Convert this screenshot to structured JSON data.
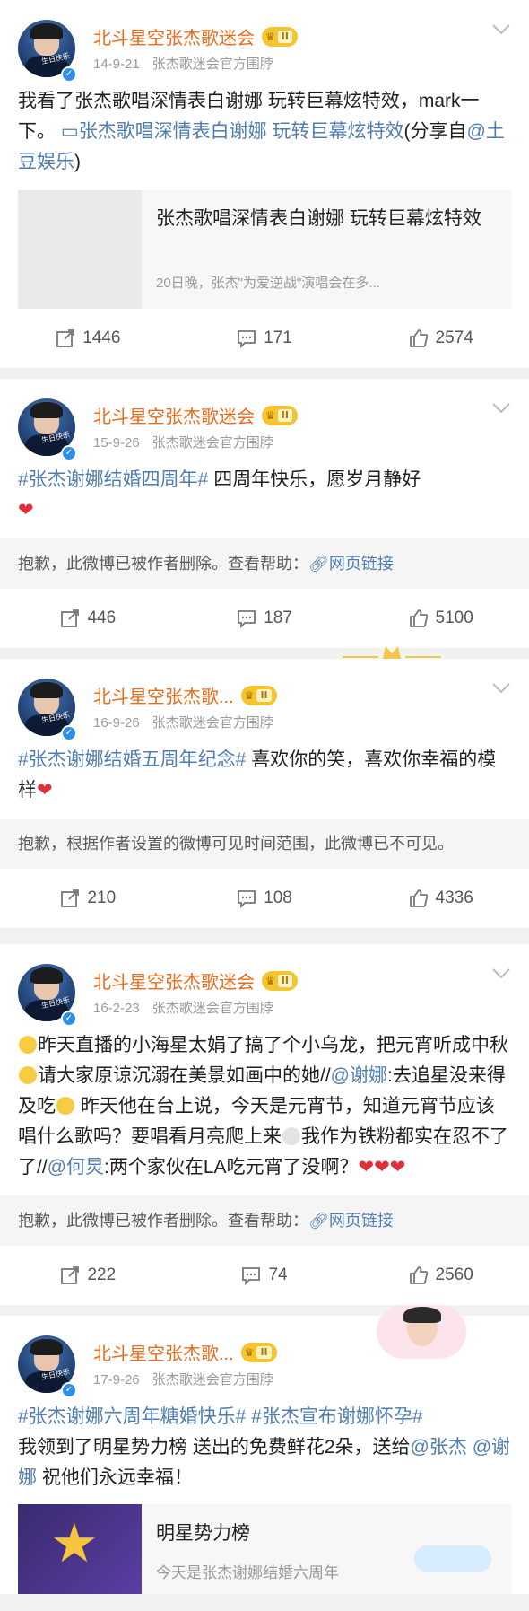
{
  "posts": [
    {
      "author": "北斗星空张杰歌迷会",
      "level": "II",
      "date": "14-9-21",
      "source": "张杰歌迷会官方围脖",
      "text_a": "我看了张杰歌唱深情表白谢娜 玩转巨幕炫特效，mark一下。",
      "text_link": "张杰歌唱深情表白谢娜 玩转巨幕炫特效",
      "text_b": "(分享自",
      "text_mention": "@土豆娱乐",
      "text_c": ")",
      "card_title": "张杰歌唱深情表白谢娜 玩转巨幕炫特效",
      "card_desc": "20日晚，张杰\"为爱逆战\"演唱会在多...",
      "reposts": "1446",
      "comments": "171",
      "likes": "2574"
    },
    {
      "author": "北斗星空张杰歌迷会",
      "level": "II",
      "date": "15-9-26",
      "source": "张杰歌迷会官方围脖",
      "text_tag": "#张杰谢娜结婚四周年#",
      "text_a": " 四周年快乐，愿岁月静好",
      "heart": "❤",
      "deleted_a": "抱歉，此微博已被作者删除。查看帮助：",
      "deleted_link": "网页链接",
      "reposts": "446",
      "comments": "187",
      "likes": "5100"
    },
    {
      "author": "北斗星空张杰歌...",
      "level": "II",
      "date": "16-9-26",
      "source": "张杰歌迷会官方围脖",
      "text_tag": "#张杰谢娜结婚五周年纪念#",
      "text_a": " 喜欢你的笑，喜欢你幸福的模样",
      "heart": "❤",
      "deleted_a": "抱歉，根据作者设置的微博可见时间范围，此微博已不可见。",
      "reposts": "210",
      "comments": "108",
      "likes": "4336"
    },
    {
      "author": "北斗星空张杰歌迷会",
      "level": "II",
      "date": "16-2-23",
      "source": "张杰歌迷会官方围脖",
      "text_a": "昨天直播的小海星太娟了搞了个小乌龙，把元宵听成中秋",
      "text_b": "请大家原谅沉溺在美景如画中的她//",
      "text_mention1": "@谢娜",
      "text_c": ":去追星没来得及吃",
      "text_d": " 昨天他在台上说，今天是元宵节，知道元宵节应该唱什么歌吗？要唱看月亮爬上来",
      "text_e": "我作为铁粉都实在忍不了了//",
      "text_mention2": "@何炅",
      "text_f": ":两个家伙在LA吃元宵了没啊？",
      "hearts": "❤❤❤",
      "deleted_a": "抱歉，此微博已被作者删除。查看帮助：",
      "deleted_link": "网页链接",
      "reposts": "222",
      "comments": "74",
      "likes": "2560"
    },
    {
      "author": "北斗星空张杰歌...",
      "level": "II",
      "date": "17-9-26",
      "source": "张杰歌迷会官方围脖",
      "text_tag1": "#张杰谢娜六周年糖婚快乐#",
      "text_tag2": "#张杰宣布谢娜怀孕#",
      "text_a": "我领到了明星势力榜 送出的免费鲜花2朵，送给",
      "text_mention1": "@张杰",
      "text_mention2": "@谢娜",
      "text_b": " 祝他们永远幸福！",
      "promo_title": "明星势力榜",
      "promo_desc": "今天是张杰谢娜结婚六周年"
    }
  ],
  "colors": {
    "name": "#e86c1c",
    "link": "#507daf",
    "muted": "#9a9a9a",
    "heart": "#e0313a"
  },
  "icons": {
    "repost": "repost-icon",
    "comment": "comment-icon",
    "like": "like-icon",
    "more": "chevron-down-icon",
    "verified": "verified-badge-icon",
    "level": "crown-icon"
  }
}
